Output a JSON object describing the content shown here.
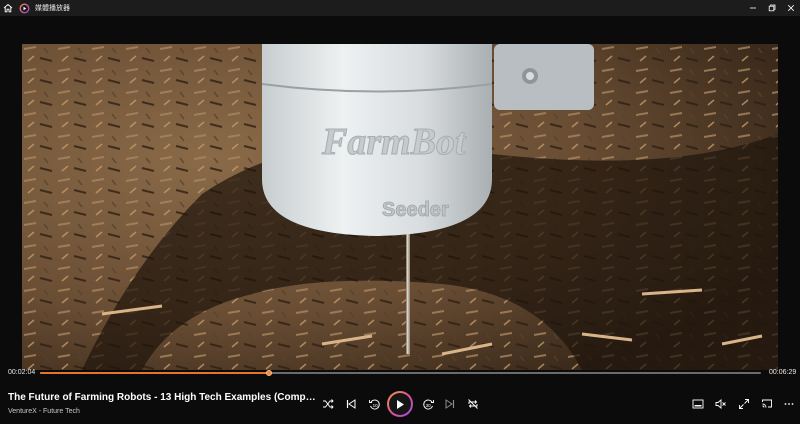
{
  "window": {
    "app_title": "媒體播放器",
    "icons": [
      "home-icon",
      "app-logo-icon",
      "minimize-icon",
      "maximize-icon",
      "close-icon"
    ]
  },
  "player": {
    "elapsed": "00:02:04",
    "duration": "00:06:29",
    "progress": 0.318
  },
  "media": {
    "title": "The Future of Farming Robots - 13 High Tech Examples (Comp…",
    "subtitle": "VentureX - Future Tech"
  },
  "controls": {
    "icons": [
      "shuffle-icon",
      "previous-icon",
      "rewind-10-icon",
      "play-icon",
      "forward-30-icon",
      "next-icon",
      "repeat-icon"
    ],
    "right_icons": [
      "miniplayer-icon",
      "mute-icon",
      "fullscreen-icon",
      "cast-icon",
      "more-icon"
    ]
  },
  "colors": {
    "accent": "#e8742a",
    "titlebar_bg": "#1c1c1c",
    "background": "#0b0b0b"
  }
}
